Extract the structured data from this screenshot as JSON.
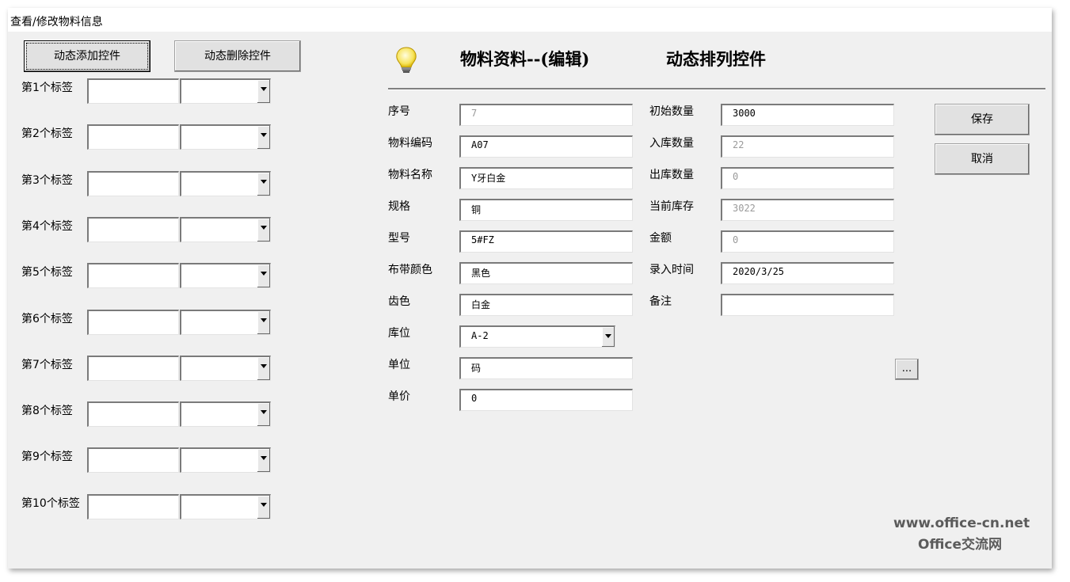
{
  "window": {
    "title": "查看/修改物料信息"
  },
  "left_panel": {
    "add_button": "动态添加控件",
    "delete_button": "动态删除控件",
    "rows": [
      {
        "label": "第1个标签"
      },
      {
        "label": "第2个标签"
      },
      {
        "label": "第3个标签"
      },
      {
        "label": "第4个标签"
      },
      {
        "label": "第5个标签"
      },
      {
        "label": "第6个标签"
      },
      {
        "label": "第7个标签"
      },
      {
        "label": "第8个标签"
      },
      {
        "label": "第9个标签"
      },
      {
        "label": "第10个标签"
      }
    ]
  },
  "header": {
    "icon": "lightbulb-icon",
    "title": "物料资料--(编辑)",
    "subtitle": "动态排列控件"
  },
  "form": {
    "left_fields": [
      {
        "label": "序号",
        "value": "7",
        "disabled": true
      },
      {
        "label": "物料编码",
        "value": "A07",
        "disabled": false
      },
      {
        "label": "物料名称",
        "value": "Y牙白金",
        "disabled": false
      },
      {
        "label": "规格",
        "value": "铜",
        "disabled": false
      },
      {
        "label": "型号",
        "value": "5#FZ",
        "disabled": false
      },
      {
        "label": "布带颜色",
        "value": "黑色",
        "disabled": false
      },
      {
        "label": "齿色",
        "value": "白金",
        "disabled": false
      },
      {
        "label": "库位",
        "value": "A-2",
        "type": "combo"
      },
      {
        "label": "单位",
        "value": "码",
        "disabled": false
      },
      {
        "label": "单价",
        "value": "0",
        "disabled": false
      }
    ],
    "right_fields": [
      {
        "label": "初始数量",
        "value": "3000",
        "disabled": false
      },
      {
        "label": "入库数量",
        "value": "22",
        "disabled": true
      },
      {
        "label": "出库数量",
        "value": "0",
        "disabled": true
      },
      {
        "label": "当前库存",
        "value": "3022",
        "disabled": true
      },
      {
        "label": "金额",
        "value": "0",
        "disabled": true
      },
      {
        "label": "录入时间",
        "value": "2020/3/25",
        "disabled": false
      },
      {
        "label": "备注",
        "value": "",
        "disabled": false
      }
    ],
    "save_button": "保存",
    "cancel_button": "取消",
    "browse_button": "..."
  },
  "watermark": {
    "line1": "www.office-cn.net",
    "line2": "Office交流网"
  }
}
